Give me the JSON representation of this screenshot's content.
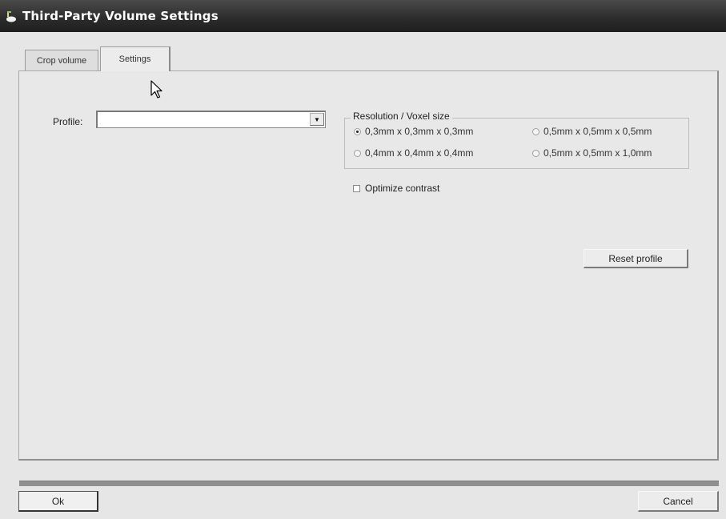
{
  "window": {
    "title": "Third-Party Volume Settings",
    "icon": "app-icon"
  },
  "tabs": [
    {
      "label": "Crop volume",
      "active": false
    },
    {
      "label": "Settings",
      "active": true
    }
  ],
  "settings": {
    "profile_label": "Profile:",
    "profile_value": "",
    "resolution_group_label": "Resolution / Voxel size",
    "resolution_options": [
      {
        "label": "0,3mm x 0,3mm x 0,3mm",
        "selected": true
      },
      {
        "label": "0,5mm x 0,5mm x 0,5mm",
        "selected": false
      },
      {
        "label": "0,4mm x 0,4mm x 0,4mm",
        "selected": false
      },
      {
        "label": "0,5mm x 0,5mm x 1,0mm",
        "selected": false
      }
    ],
    "optimize_contrast_label": "Optimize contrast",
    "optimize_contrast_checked": false,
    "reset_label": "Reset profile"
  },
  "footer": {
    "ok_label": "Ok",
    "cancel_label": "Cancel"
  },
  "colors": {
    "titlebar": "#2b2b2b",
    "background": "#e6e6e6"
  }
}
